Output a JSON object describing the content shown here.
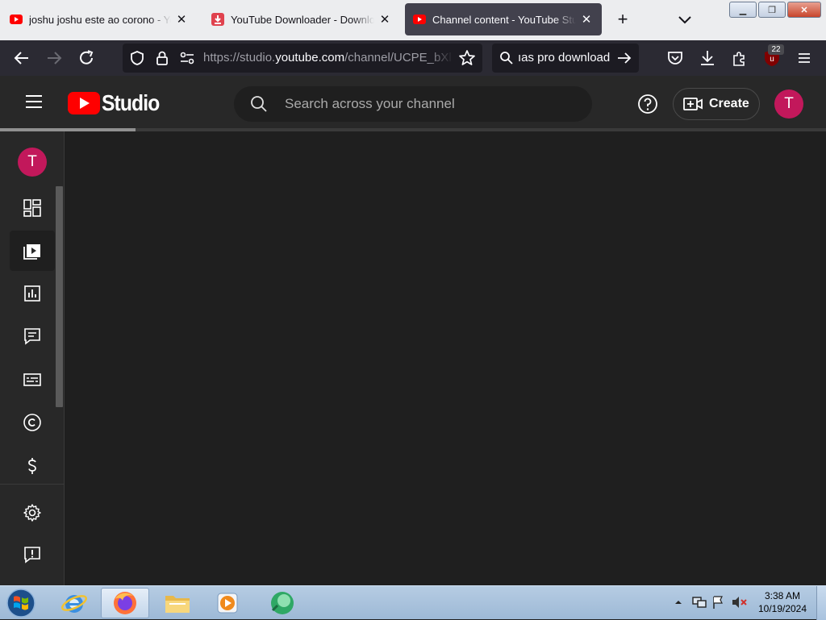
{
  "browser": {
    "tabs": [
      {
        "title": "joshu joshu este ao corono - YouTube",
        "favicon": "youtube-icon",
        "active": false
      },
      {
        "title": "YouTube Downloader - Download",
        "favicon": "downloader-icon",
        "active": false
      },
      {
        "title": "Channel content - YouTube Studio",
        "favicon": "youtube-icon",
        "active": true
      }
    ],
    "url_prefix": "https://studio.",
    "url_host": "youtube.com",
    "url_path": "/channel/UCPE_bXl",
    "search_text": "ıas pro download",
    "extension_badge": "22"
  },
  "studio": {
    "logo_text": "Studio",
    "search_placeholder": "Search across your channel",
    "create_label": "Create",
    "avatar_letter": "T",
    "sidebar": [
      {
        "name": "dashboard",
        "icon": "dashboard-icon",
        "active": false
      },
      {
        "name": "content",
        "icon": "content-icon",
        "active": true
      },
      {
        "name": "analytics",
        "icon": "analytics-icon",
        "active": false
      },
      {
        "name": "comments",
        "icon": "comments-icon",
        "active": false
      },
      {
        "name": "subtitles",
        "icon": "subtitles-icon",
        "active": false
      },
      {
        "name": "copyright",
        "icon": "copyright-icon",
        "active": false
      },
      {
        "name": "earn",
        "icon": "dollar-icon",
        "active": false
      },
      {
        "name": "settings",
        "icon": "gear-icon",
        "active": false
      },
      {
        "name": "feedback",
        "icon": "feedback-icon",
        "active": false
      }
    ]
  },
  "taskbar": {
    "time": "3:38 AM",
    "date": "10/19/2024"
  },
  "colors": {
    "youtube_red": "#ff0000",
    "avatar": "#c2185b",
    "studio_bg": "#282828",
    "content_bg": "#1f1f1f"
  }
}
